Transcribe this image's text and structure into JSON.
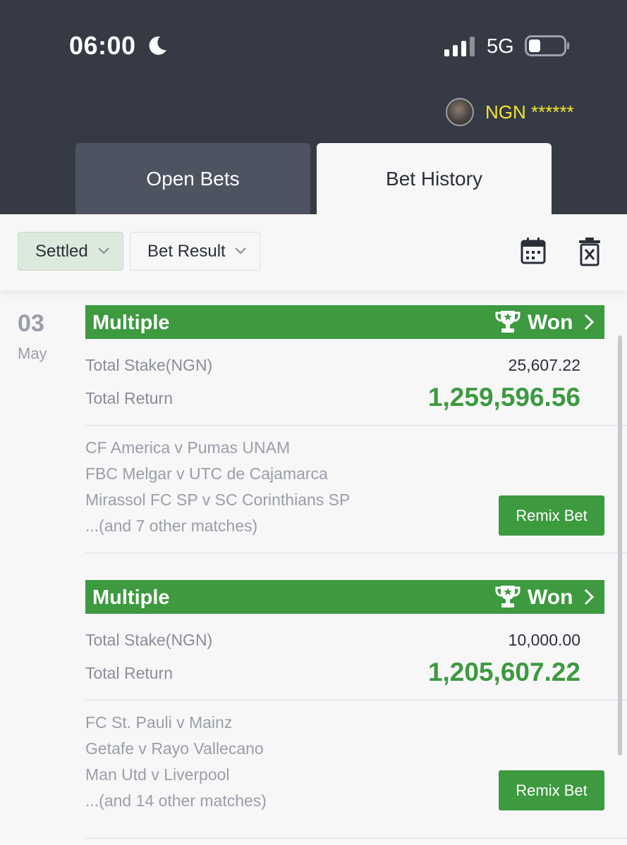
{
  "status_bar": {
    "time": "06:00",
    "network": "5G",
    "icons": [
      "moon-icon",
      "signal-icon",
      "battery-icon"
    ]
  },
  "account": {
    "currency": "NGN",
    "balance_masked": "******",
    "label": "NGN ******"
  },
  "tabs": [
    {
      "label": "Open Bets",
      "active": false
    },
    {
      "label": "Bet History",
      "active": true
    }
  ],
  "filters": {
    "settled": "Settled",
    "bet_result": "Bet Result",
    "icons": [
      "calendar-icon",
      "delete-icon"
    ]
  },
  "date": {
    "day": "03",
    "month": "May"
  },
  "bets": [
    {
      "type": "Multiple",
      "status": "Won",
      "stake_label": "Total Stake(NGN)",
      "stake": "25,607.22",
      "return_label": "Total Return",
      "total_return": "1,259,596.56",
      "matches": [
        "CF America v Pumas UNAM",
        "FBC Melgar v UTC de Cajamarca",
        "Mirassol FC SP v SC Corinthians SP"
      ],
      "more": "...(and 7 other matches)",
      "remix_label": "Remix Bet"
    },
    {
      "type": "Multiple",
      "status": "Won",
      "stake_label": "Total Stake(NGN)",
      "stake": "10,000.00",
      "return_label": "Total Return",
      "total_return": "1,205,607.22",
      "matches": [
        "FC St. Pauli v Mainz",
        "Getafe v Rayo Vallecano",
        "Man Utd v Liverpool"
      ],
      "more": "...(and 14 other matches)",
      "remix_label": "Remix Bet"
    }
  ],
  "colors": {
    "header": "#353a45",
    "accent_green": "#3d9a3f",
    "balance_yellow": "#f6e531"
  }
}
